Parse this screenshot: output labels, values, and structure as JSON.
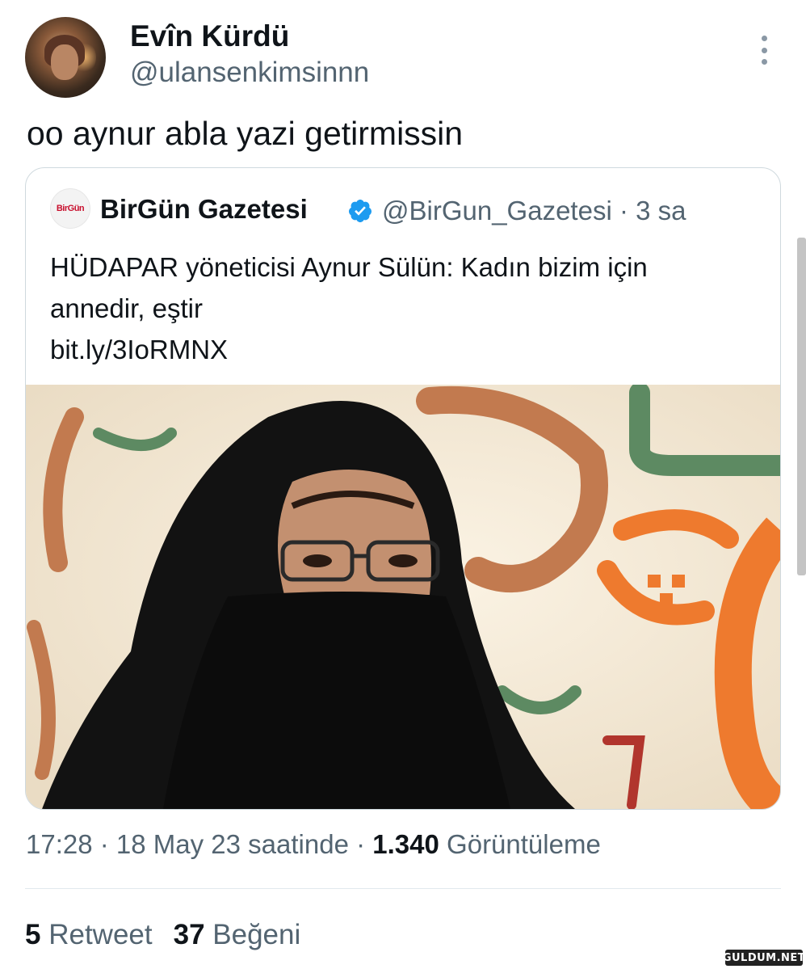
{
  "tweet": {
    "author_name": "Evîn Kürdü",
    "author_handle": "@ulansenkimsinnn",
    "text": "oo aynur abla yazi getirmissin",
    "time": "17:28",
    "date": "18 May 23 saatinde",
    "views_count": "1.340",
    "views_label": "Görüntüleme",
    "retweets_count": "5",
    "retweets_label": "Retweet",
    "likes_count": "37",
    "likes_label": "Beğeni"
  },
  "quoted_tweet": {
    "logo_text": "BirGün",
    "author_name": "BirGün Gazetesi",
    "author_handle": "@BirGun_Gazetesi",
    "age": "3 sa",
    "text_line1": "HÜDAPAR yöneticisi Aynur Sülün: Kadın bizim için",
    "text_line2": "annedir, eştir",
    "link": "bit.ly/3IoRMNX"
  },
  "watermark": "GULDUM.NET",
  "colors": {
    "secondary_text": "#536471",
    "verified": "#1d9bf0",
    "border": "#cfd9de"
  }
}
